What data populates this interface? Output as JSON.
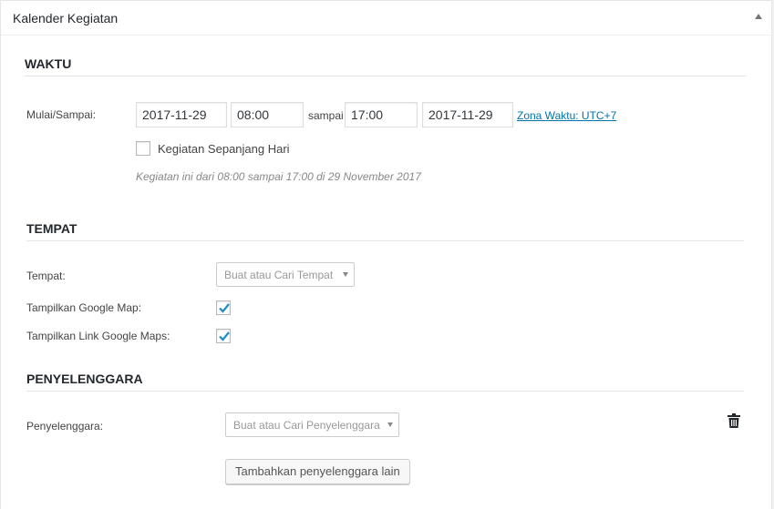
{
  "panel": {
    "title": "Kalender Kegiatan"
  },
  "waktu": {
    "heading": "WAKTU",
    "label": "Mulai/Sampai:",
    "start_date": "2017-11-29",
    "start_time": "08:00",
    "between": "sampai",
    "end_time": "17:00",
    "end_date": "2017-11-29",
    "timezone_link": "Zona Waktu: UTC+7",
    "all_day_label": "Kegiatan Sepanjang Hari",
    "all_day_checked": false,
    "summary": "Kegiatan ini dari 08:00 sampai 17:00 di 29 November 2017"
  },
  "tempat": {
    "heading": "TEMPAT",
    "venue_label": "Tempat:",
    "venue_placeholder": "Buat atau Cari Tempat",
    "show_map_label": "Tampilkan Google Map:",
    "show_map_checked": true,
    "show_map_link_label": "Tampilkan Link Google Maps:",
    "show_map_link_checked": true
  },
  "penyelenggara": {
    "heading": "PENYELENGGARA",
    "organizer_label": "Penyelenggara:",
    "organizer_placeholder": "Buat atau Cari Penyelenggara",
    "add_button": "Tambahkan penyelenggara lain"
  },
  "colors": {
    "accent": "#0073aa",
    "check": "#1e8cbe"
  },
  "icons": {
    "collapse": "triangle-up",
    "delete": "trash-icon",
    "check": "checkmark"
  }
}
